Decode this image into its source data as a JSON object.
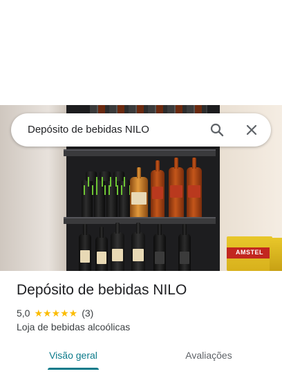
{
  "search": {
    "query": "Depósito de bebidas NILO"
  },
  "icons": {
    "search": "search-icon",
    "close": "close-icon",
    "star": "star-icon"
  },
  "photo": {
    "box_text": "AMSTEL"
  },
  "place": {
    "title": "Depósito de bebidas NILO",
    "rating": "5,0",
    "stars": "★★★★★",
    "review_count": "(3)",
    "category": "Loja de bebidas alcoólicas"
  },
  "tabs": [
    {
      "label": "Visão geral",
      "active": true
    },
    {
      "label": "Avaliações",
      "active": false
    }
  ],
  "colors": {
    "accent": "#0b7a8a",
    "star": "#fbbc04",
    "text_primary": "#202124",
    "text_secondary": "#3c4043",
    "tab_inactive": "#5f6368"
  }
}
